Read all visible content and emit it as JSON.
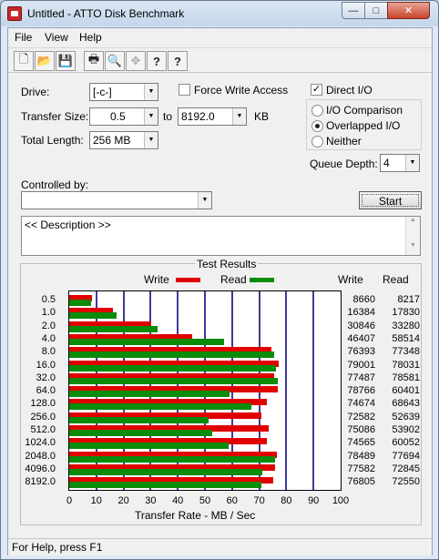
{
  "window": {
    "title": "Untitled - ATTO Disk Benchmark",
    "minimize_glyph": "—",
    "maximize_glyph": "□",
    "close_glyph": "✕"
  },
  "menu": [
    "File",
    "View",
    "Help"
  ],
  "toolbar": {
    "icons": [
      "new-icon",
      "open-icon",
      "save-icon",
      "print-icon",
      "print-preview-icon",
      "move-icon",
      "help-icon",
      "context-help-icon"
    ],
    "glyphs": [
      "🗋",
      "📂",
      "💾",
      "🖶",
      "🔍",
      "✥",
      "?",
      "?"
    ]
  },
  "settings": {
    "drive_label": "Drive:",
    "drive_value": "[-c-]",
    "force_write_label": "Force Write Access",
    "force_write_checked": false,
    "direct_io_label": "Direct I/O",
    "direct_io_checked": true,
    "transfer_size_label": "Transfer Size:",
    "transfer_from": "0.5",
    "transfer_to_label": "to",
    "transfer_to": "8192.0",
    "transfer_unit": "KB",
    "total_length_label": "Total Length:",
    "total_length_value": "256 MB",
    "io_modes": [
      {
        "label": "I/O Comparison",
        "selected": false
      },
      {
        "label": "Overlapped I/O",
        "selected": true
      },
      {
        "label": "Neither",
        "selected": false
      }
    ],
    "queue_depth_label": "Queue Depth:",
    "queue_depth_value": "4",
    "controlled_by_label": "Controlled by:",
    "controlled_by_value": "",
    "start_label": "Start",
    "description": "<< Description >>",
    "check_glyph": "✓",
    "arrow_glyph": "▼",
    "scroll_up_glyph": "▲",
    "scroll_down_glyph": "▼"
  },
  "results": {
    "group_title": "Test Results",
    "legend_write": "Write",
    "legend_read": "Read",
    "col_write": "Write",
    "col_read": "Read"
  },
  "chart_data": {
    "type": "bar",
    "orientation": "horizontal",
    "categories": [
      "0.5",
      "1.0",
      "2.0",
      "4.0",
      "8.0",
      "16.0",
      "32.0",
      "64.0",
      "128.0",
      "256.0",
      "512.0",
      "1024.0",
      "2048.0",
      "4096.0",
      "8192.0"
    ],
    "series": [
      {
        "name": "Write",
        "color": "#e00000",
        "values": [
          8660,
          16384,
          30846,
          46407,
          76393,
          79001,
          77487,
          78766,
          74674,
          72582,
          75086,
          74565,
          78489,
          77582,
          76805
        ]
      },
      {
        "name": "Read",
        "color": "#0a8c0a",
        "values": [
          8217,
          17830,
          33280,
          58514,
          77348,
          78031,
          78581,
          60401,
          68643,
          52639,
          53902,
          60052,
          77694,
          72845,
          72550
        ]
      }
    ],
    "xlabel": "Transfer Rate - MB / Sec",
    "xticks": [
      "0",
      "10",
      "20",
      "30",
      "40",
      "50",
      "60",
      "70",
      "80",
      "90",
      "100"
    ],
    "xlim": [
      0,
      100
    ],
    "grid": true,
    "legend": "top"
  },
  "status_text": "For Help, press F1"
}
